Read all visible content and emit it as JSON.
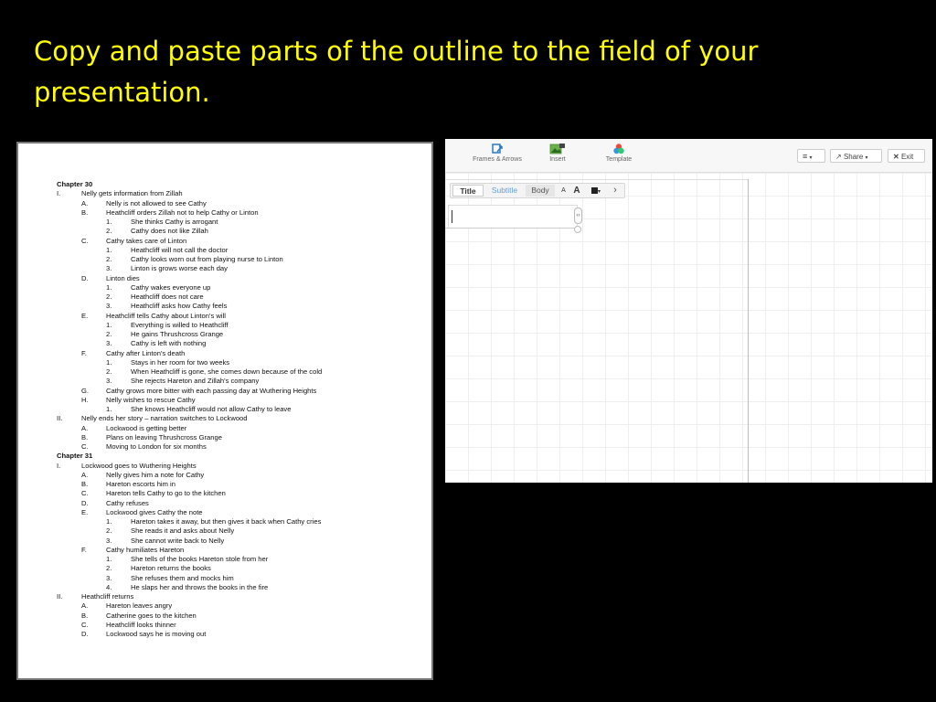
{
  "slide": {
    "title": "Copy and paste parts of the outline to the field of your presentation."
  },
  "outline": [
    {
      "level": 0,
      "label": "",
      "text": "Chapter 30"
    },
    {
      "level": 1,
      "label": "I.",
      "text": "Nelly gets information  from Zillah"
    },
    {
      "level": 2,
      "label": "A.",
      "text": "Nelly is not  allowed  to see  Cathy"
    },
    {
      "level": 2,
      "label": "B.",
      "text": "Heathcliff  orders  Zillah not  to help Cathy  or Linton"
    },
    {
      "level": 3,
      "label": "1.",
      "text": "She thinks  Cathy  is arrogant"
    },
    {
      "level": 3,
      "label": "2.",
      "text": "Cathy  does  not like Zillah"
    },
    {
      "level": 2,
      "label": "C.",
      "text": "Cathy  takes  care  of Linton"
    },
    {
      "level": 3,
      "label": "1.",
      "text": "Heathcliff will not call the doctor"
    },
    {
      "level": 3,
      "label": "2.",
      "text": "Cathy  looks  worn  out from  playing  nurse to Linton"
    },
    {
      "level": 3,
      "label": "3.",
      "text": "Linton is grows worse  each  day"
    },
    {
      "level": 2,
      "label": "D.",
      "text": "Linton  dies"
    },
    {
      "level": 3,
      "label": "1.",
      "text": "Cathy  wakes  everyone  up"
    },
    {
      "level": 3,
      "label": "2.",
      "text": "Heathcliff  does  not care"
    },
    {
      "level": 3,
      "label": "3.",
      "text": "Heathcliff  asks  how  Cathy  feels"
    },
    {
      "level": 2,
      "label": "E.",
      "text": "Heathcliff  tells Cathy  about  Linton's  will"
    },
    {
      "level": 3,
      "label": "1.",
      "text": "Everything  is willed to  Heathcliff"
    },
    {
      "level": 3,
      "label": "2.",
      "text": "He gains  Thrushcross  Grange"
    },
    {
      "level": 3,
      "label": "3.",
      "text": "Cathy  is left  with nothing"
    },
    {
      "level": 2,
      "label": "F.",
      "text": "Cathy  after  Linton's  death"
    },
    {
      "level": 3,
      "label": "1.",
      "text": "Stays  in her  room  for two weeks"
    },
    {
      "level": 3,
      "label": "2.",
      "text": "When  Heathcliff  is gone,  she comes down  because  of the cold"
    },
    {
      "level": 3,
      "label": "3.",
      "text": "She rejects  Hareton  and  Zillah's company"
    },
    {
      "level": 2,
      "label": "G.",
      "text": "Cathy  grows more  bitter  with each  passing  day at Wuthering  Heights"
    },
    {
      "level": 2,
      "label": "H.",
      "text": "Nelly wishes  to rescue  Cathy"
    },
    {
      "level": 3,
      "label": "1.",
      "text": "She knows  Heathcliff  would  not allow  Cathy  to leave"
    },
    {
      "level": 1,
      "label": "II.",
      "text": "Nelly ends  her story – narration  switches  to Lockwood"
    },
    {
      "level": 2,
      "label": "A.",
      "text": "Lockwood  is getting  better"
    },
    {
      "level": 2,
      "label": "B.",
      "text": "Plans  on leaving  Thrushcross  Grange"
    },
    {
      "level": 2,
      "label": "C.",
      "text": "Moving  to London   for six months"
    },
    {
      "level": 0,
      "label": "",
      "text": "Chapter 31"
    },
    {
      "level": 1,
      "label": "I.",
      "text": "Lockwood  goes  to Wuthering  Heights"
    },
    {
      "level": 2,
      "label": "A.",
      "text": "Nelly gives  him a note  for Cathy"
    },
    {
      "level": 2,
      "label": "B.",
      "text": "Hareton  escorts  him in"
    },
    {
      "level": 2,
      "label": "C.",
      "text": "Hareton  tells Cathy  to go to the  kitchen"
    },
    {
      "level": 2,
      "label": "D.",
      "text": "Cathy  refuses"
    },
    {
      "level": 2,
      "label": "E.",
      "text": "Lockwood  gives  Cathy  the note"
    },
    {
      "level": 3,
      "label": "1.",
      "text": "Hareton  takes  it away,  but then  gives  it back  when  Cathy  cries"
    },
    {
      "level": 3,
      "label": "2.",
      "text": "She reads  it and  asks  about  Nelly"
    },
    {
      "level": 3,
      "label": "3.",
      "text": "She cannot  write back  to Nelly"
    },
    {
      "level": 2,
      "label": "F.",
      "text": "Cathy  humiliates  Hareton"
    },
    {
      "level": 3,
      "label": "1.",
      "text": "She tells of the books  Hareton  stole  from her"
    },
    {
      "level": 3,
      "label": "2.",
      "text": "Hareton  returns  the  books"
    },
    {
      "level": 3,
      "label": "3.",
      "text": "She refuses  them  and  mocks him"
    },
    {
      "level": 3,
      "label": "4.",
      "text": "He slaps  her and  throws  the  books  in the fire"
    },
    {
      "level": 1,
      "label": "II.",
      "text": "Heathcliff  returns"
    },
    {
      "level": 2,
      "label": "A.",
      "text": "Hareton  leaves  angry"
    },
    {
      "level": 2,
      "label": "B.",
      "text": "Catherine  goes  to the kitchen"
    },
    {
      "level": 2,
      "label": "C.",
      "text": "Heathcliff  looks  thinner"
    },
    {
      "level": 2,
      "label": "D.",
      "text": "Lockwood  says  he is moving  out"
    }
  ],
  "app": {
    "menu": {
      "frames": "Frames & Arrows",
      "insert": "Insert",
      "template": "Template"
    },
    "buttons": {
      "list_icon_arrow": "▾",
      "share": "Share",
      "share_arrow": "▾",
      "exit": "Exit",
      "close_glyph": "✕"
    },
    "toolbar": {
      "title": "Title",
      "subtitle": "Subtitle",
      "body": "Body",
      "small_a": "A",
      "big_a": "A",
      "color_arrow": "▾",
      "next": "›"
    },
    "handle_glyph": "‹›"
  }
}
